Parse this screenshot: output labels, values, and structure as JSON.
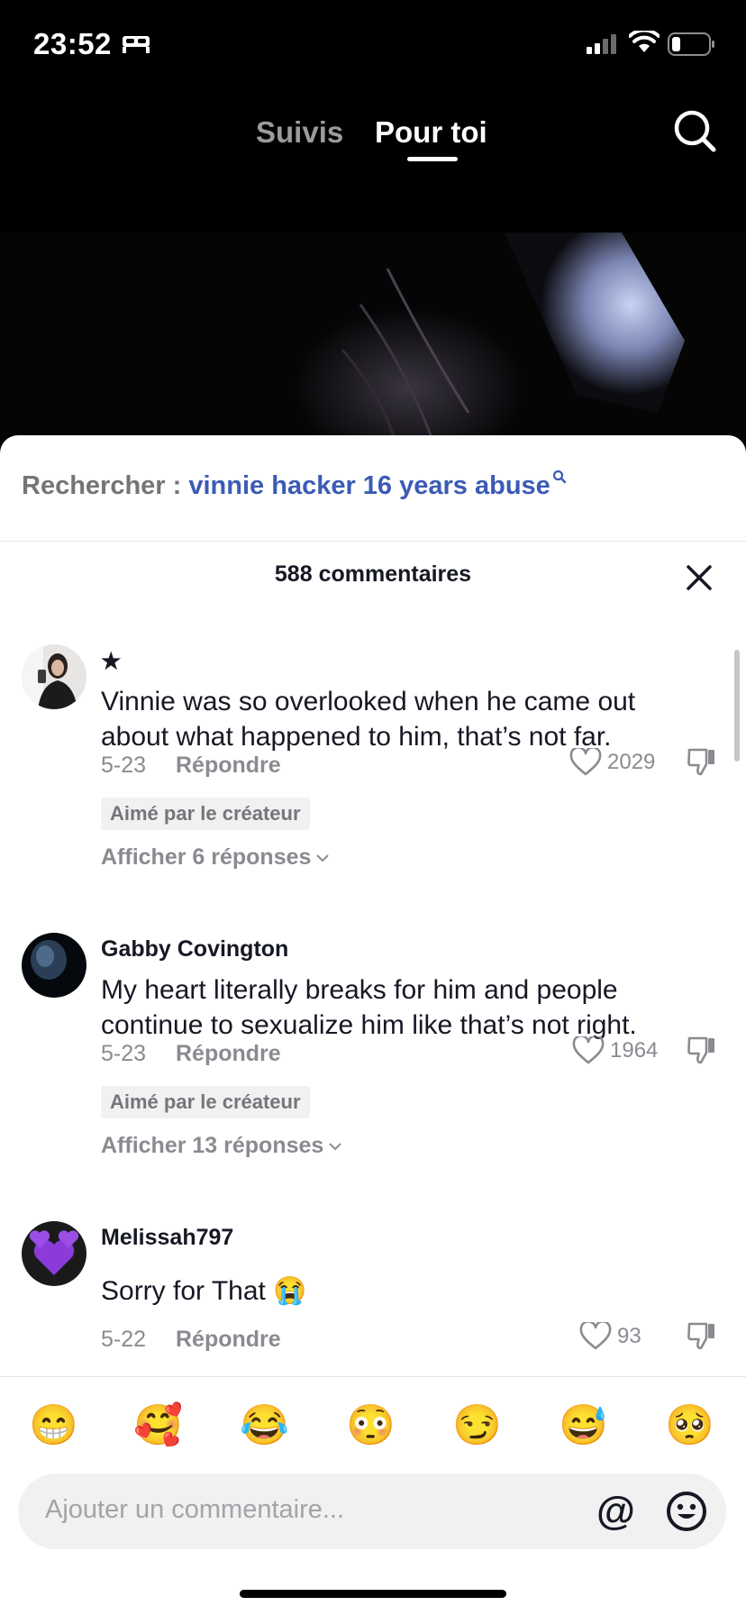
{
  "status_bar": {
    "time": "23:52"
  },
  "top_nav": {
    "tab_following": "Suivis",
    "tab_foryou": "Pour toi"
  },
  "search_suggest": {
    "prefix": "Rechercher :",
    "query": "vinnie hacker 16 years abuse"
  },
  "comments": {
    "header": "588 commentaires",
    "items": [
      {
        "username": "★",
        "text": "Vinnie was so overlooked when he came out about what happened to him, that’s not far.",
        "date": "5-23",
        "reply": "Répondre",
        "likes": "2029",
        "badge": "Aimé par le créateur",
        "view_replies": "Afficher 6 réponses"
      },
      {
        "username": "Gabby Covington",
        "text": "My heart literally breaks for him and people continue to sexualize him like that’s not right.",
        "date": "5-23",
        "reply": "Répondre",
        "likes": "1964",
        "badge": "Aimé par le créateur",
        "view_replies": "Afficher 13 réponses"
      },
      {
        "username": "Melissah797",
        "text": "Sorry for That 😭",
        "date": "5-22",
        "reply": "Répondre",
        "likes": "93"
      }
    ]
  },
  "emoji_bar": [
    "😁",
    "🥰",
    "😂",
    "😳",
    "😏",
    "😅",
    "🥺"
  ],
  "comment_input": {
    "placeholder": "Ajouter un commentaire...",
    "at_symbol": "@"
  },
  "colors": {
    "link_blue": "#3b5bb5",
    "muted": "#8a8b91"
  }
}
